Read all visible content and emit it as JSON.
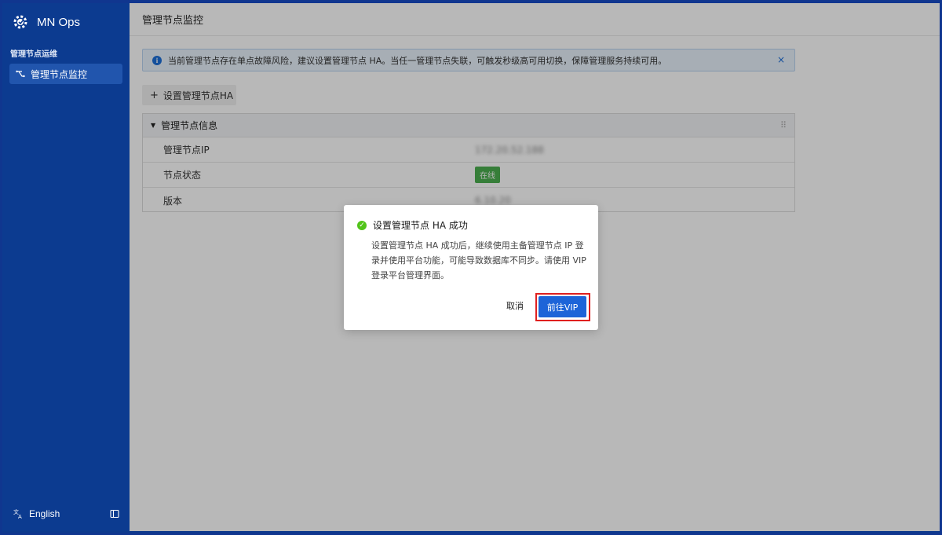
{
  "app": {
    "name": "MN Ops"
  },
  "sidebar": {
    "section_title": "管理节点运维",
    "items": [
      {
        "label": "管理节点监控",
        "icon": "topology-icon"
      }
    ],
    "footer": {
      "language": "English"
    }
  },
  "main": {
    "page_title": "管理节点监控",
    "alert": {
      "text": "当前管理节点存在单点故障风险，建议设置管理节点 HA。当任一管理节点失联，可触发秒级高可用切换，保障管理服务持续可用。",
      "close_symbol": "×"
    },
    "ha_button_label": "设置管理节点HA",
    "panel": {
      "title": "管理节点信息",
      "rows": [
        {
          "key": "管理节点IP",
          "value": "172.20.52.188"
        },
        {
          "key": "节点状态",
          "value": "在线"
        },
        {
          "key": "版本",
          "value": "6.10.20"
        }
      ]
    }
  },
  "dialog": {
    "title": "设置管理节点 HA 成功",
    "body": "设置管理节点 HA 成功后，继续使用主备管理节点 IP 登录并使用平台功能，可能导致数据库不同步。请使用 VIP 登录平台管理界面。",
    "cancel_label": "取消",
    "confirm_label": "前往VIP"
  },
  "colors": {
    "sidebar_bg": "#0c3b90",
    "sidebar_active": "#2155ad",
    "primary": "#1d64d8",
    "success": "#52c41a",
    "highlight_outline": "#e0201f"
  }
}
